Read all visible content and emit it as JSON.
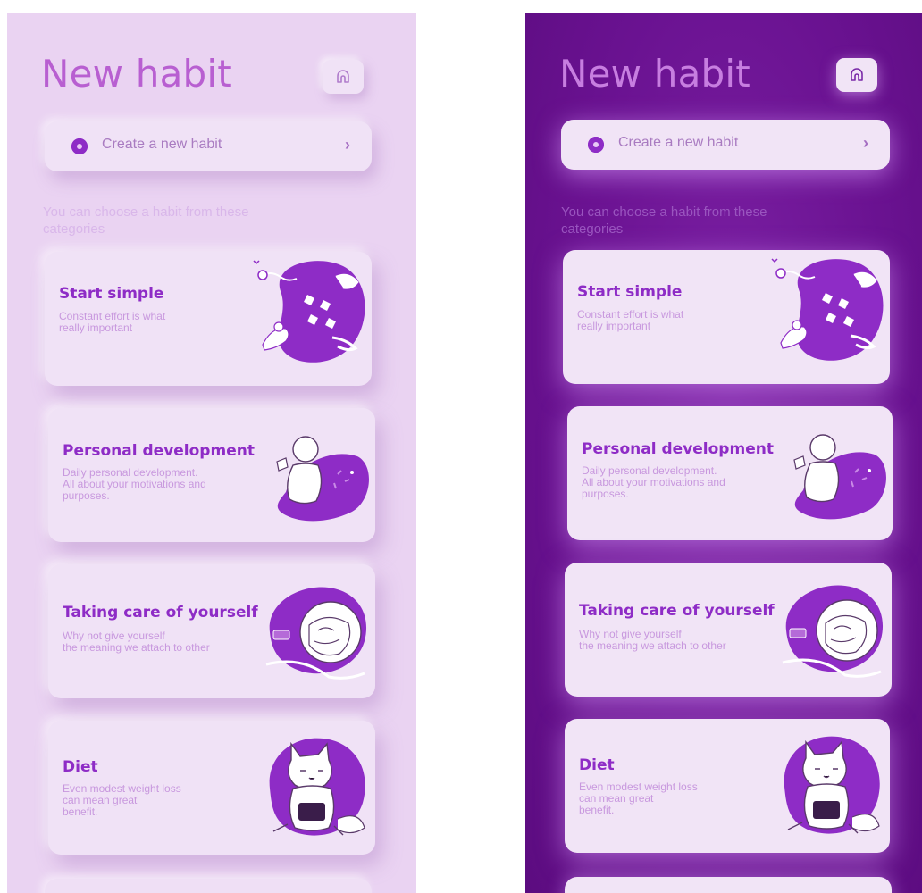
{
  "header": {
    "title": "New habit"
  },
  "create": {
    "label": "Create a new habit",
    "chevron": "›"
  },
  "hint": "You can choose a habit from these categories",
  "categories": [
    {
      "title": "Start simple",
      "description": "Constant effort is what\nreally important"
    },
    {
      "title": "Personal development",
      "description": "Daily personal development.\n All about your motivations and\npurposes."
    },
    {
      "title": "Taking care of yourself",
      "description": "Why not give yourself\nthe meaning we attach to other"
    },
    {
      "title": "Diet",
      "description": "Even modest weight loss\ncan mean great\nbenefit."
    }
  ],
  "icons": {
    "home": "home-icon",
    "radio": "radio-selected-icon",
    "chevron": "chevron-right-icon"
  },
  "colors": {
    "accent": "#8e2cc6",
    "light_background": "#ead3f2",
    "dark_background": "#6a1291",
    "card": "#f0e2f6",
    "title": "#b85fd1"
  }
}
